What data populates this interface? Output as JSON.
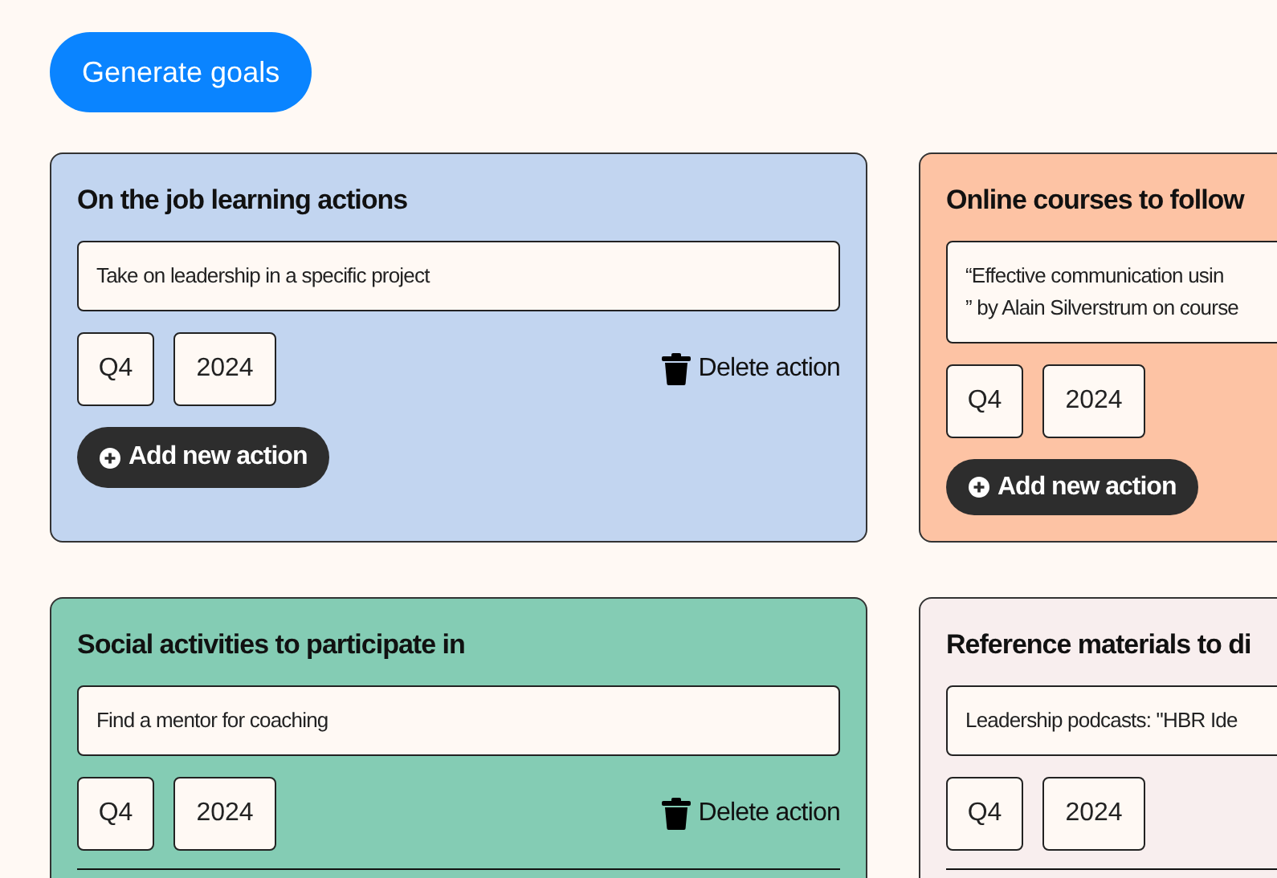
{
  "generate_button": "Generate goals",
  "cards": [
    {
      "title": "On the job learning actions",
      "color": "#c2d5f0",
      "actions": [
        {
          "lines": [
            "Take on leadership in a specific project"
          ],
          "quarter": "Q4",
          "year": "2024",
          "delete_label": "Delete action",
          "separated": false
        }
      ],
      "add_label": "Add new action"
    },
    {
      "title": "Online courses to follow",
      "color": "#fdc3a4",
      "actions": [
        {
          "lines": [
            "“Effective communication usin",
            "” by Alain Silverstrum on course"
          ],
          "quarter": "Q4",
          "year": "2024",
          "separated": false
        }
      ],
      "add_label": "Add new action"
    },
    {
      "title": "Social activities to participate in",
      "color": "#84ccb4",
      "actions": [
        {
          "lines": [
            "Find a mentor for coaching"
          ],
          "quarter": "Q4",
          "year": "2024",
          "delete_label": "Delete action",
          "separated": true
        }
      ]
    },
    {
      "title": "Reference materials to di",
      "color": "#f8eeee",
      "actions": [
        {
          "lines": [
            "Leadership podcasts: \"HBR Ide"
          ],
          "quarter": "Q4",
          "year": "2024",
          "separated": true
        }
      ]
    }
  ]
}
